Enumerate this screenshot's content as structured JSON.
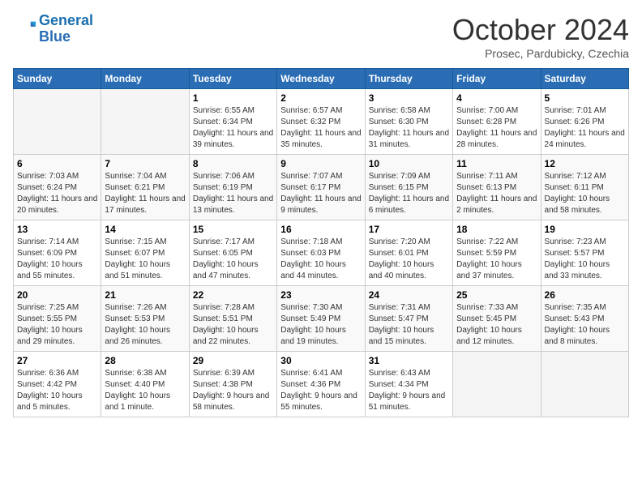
{
  "logo": {
    "line1": "General",
    "line2": "Blue"
  },
  "title": "October 2024",
  "subtitle": "Prosec, Pardubicky, Czechia",
  "weekdays": [
    "Sunday",
    "Monday",
    "Tuesday",
    "Wednesday",
    "Thursday",
    "Friday",
    "Saturday"
  ],
  "weeks": [
    [
      {
        "num": "",
        "info": ""
      },
      {
        "num": "",
        "info": ""
      },
      {
        "num": "1",
        "info": "Sunrise: 6:55 AM\nSunset: 6:34 PM\nDaylight: 11 hours and 39 minutes."
      },
      {
        "num": "2",
        "info": "Sunrise: 6:57 AM\nSunset: 6:32 PM\nDaylight: 11 hours and 35 minutes."
      },
      {
        "num": "3",
        "info": "Sunrise: 6:58 AM\nSunset: 6:30 PM\nDaylight: 11 hours and 31 minutes."
      },
      {
        "num": "4",
        "info": "Sunrise: 7:00 AM\nSunset: 6:28 PM\nDaylight: 11 hours and 28 minutes."
      },
      {
        "num": "5",
        "info": "Sunrise: 7:01 AM\nSunset: 6:26 PM\nDaylight: 11 hours and 24 minutes."
      }
    ],
    [
      {
        "num": "6",
        "info": "Sunrise: 7:03 AM\nSunset: 6:24 PM\nDaylight: 11 hours and 20 minutes."
      },
      {
        "num": "7",
        "info": "Sunrise: 7:04 AM\nSunset: 6:21 PM\nDaylight: 11 hours and 17 minutes."
      },
      {
        "num": "8",
        "info": "Sunrise: 7:06 AM\nSunset: 6:19 PM\nDaylight: 11 hours and 13 minutes."
      },
      {
        "num": "9",
        "info": "Sunrise: 7:07 AM\nSunset: 6:17 PM\nDaylight: 11 hours and 9 minutes."
      },
      {
        "num": "10",
        "info": "Sunrise: 7:09 AM\nSunset: 6:15 PM\nDaylight: 11 hours and 6 minutes."
      },
      {
        "num": "11",
        "info": "Sunrise: 7:11 AM\nSunset: 6:13 PM\nDaylight: 11 hours and 2 minutes."
      },
      {
        "num": "12",
        "info": "Sunrise: 7:12 AM\nSunset: 6:11 PM\nDaylight: 10 hours and 58 minutes."
      }
    ],
    [
      {
        "num": "13",
        "info": "Sunrise: 7:14 AM\nSunset: 6:09 PM\nDaylight: 10 hours and 55 minutes."
      },
      {
        "num": "14",
        "info": "Sunrise: 7:15 AM\nSunset: 6:07 PM\nDaylight: 10 hours and 51 minutes."
      },
      {
        "num": "15",
        "info": "Sunrise: 7:17 AM\nSunset: 6:05 PM\nDaylight: 10 hours and 47 minutes."
      },
      {
        "num": "16",
        "info": "Sunrise: 7:18 AM\nSunset: 6:03 PM\nDaylight: 10 hours and 44 minutes."
      },
      {
        "num": "17",
        "info": "Sunrise: 7:20 AM\nSunset: 6:01 PM\nDaylight: 10 hours and 40 minutes."
      },
      {
        "num": "18",
        "info": "Sunrise: 7:22 AM\nSunset: 5:59 PM\nDaylight: 10 hours and 37 minutes."
      },
      {
        "num": "19",
        "info": "Sunrise: 7:23 AM\nSunset: 5:57 PM\nDaylight: 10 hours and 33 minutes."
      }
    ],
    [
      {
        "num": "20",
        "info": "Sunrise: 7:25 AM\nSunset: 5:55 PM\nDaylight: 10 hours and 29 minutes."
      },
      {
        "num": "21",
        "info": "Sunrise: 7:26 AM\nSunset: 5:53 PM\nDaylight: 10 hours and 26 minutes."
      },
      {
        "num": "22",
        "info": "Sunrise: 7:28 AM\nSunset: 5:51 PM\nDaylight: 10 hours and 22 minutes."
      },
      {
        "num": "23",
        "info": "Sunrise: 7:30 AM\nSunset: 5:49 PM\nDaylight: 10 hours and 19 minutes."
      },
      {
        "num": "24",
        "info": "Sunrise: 7:31 AM\nSunset: 5:47 PM\nDaylight: 10 hours and 15 minutes."
      },
      {
        "num": "25",
        "info": "Sunrise: 7:33 AM\nSunset: 5:45 PM\nDaylight: 10 hours and 12 minutes."
      },
      {
        "num": "26",
        "info": "Sunrise: 7:35 AM\nSunset: 5:43 PM\nDaylight: 10 hours and 8 minutes."
      }
    ],
    [
      {
        "num": "27",
        "info": "Sunrise: 6:36 AM\nSunset: 4:42 PM\nDaylight: 10 hours and 5 minutes."
      },
      {
        "num": "28",
        "info": "Sunrise: 6:38 AM\nSunset: 4:40 PM\nDaylight: 10 hours and 1 minute."
      },
      {
        "num": "29",
        "info": "Sunrise: 6:39 AM\nSunset: 4:38 PM\nDaylight: 9 hours and 58 minutes."
      },
      {
        "num": "30",
        "info": "Sunrise: 6:41 AM\nSunset: 4:36 PM\nDaylight: 9 hours and 55 minutes."
      },
      {
        "num": "31",
        "info": "Sunrise: 6:43 AM\nSunset: 4:34 PM\nDaylight: 9 hours and 51 minutes."
      },
      {
        "num": "",
        "info": ""
      },
      {
        "num": "",
        "info": ""
      }
    ]
  ]
}
